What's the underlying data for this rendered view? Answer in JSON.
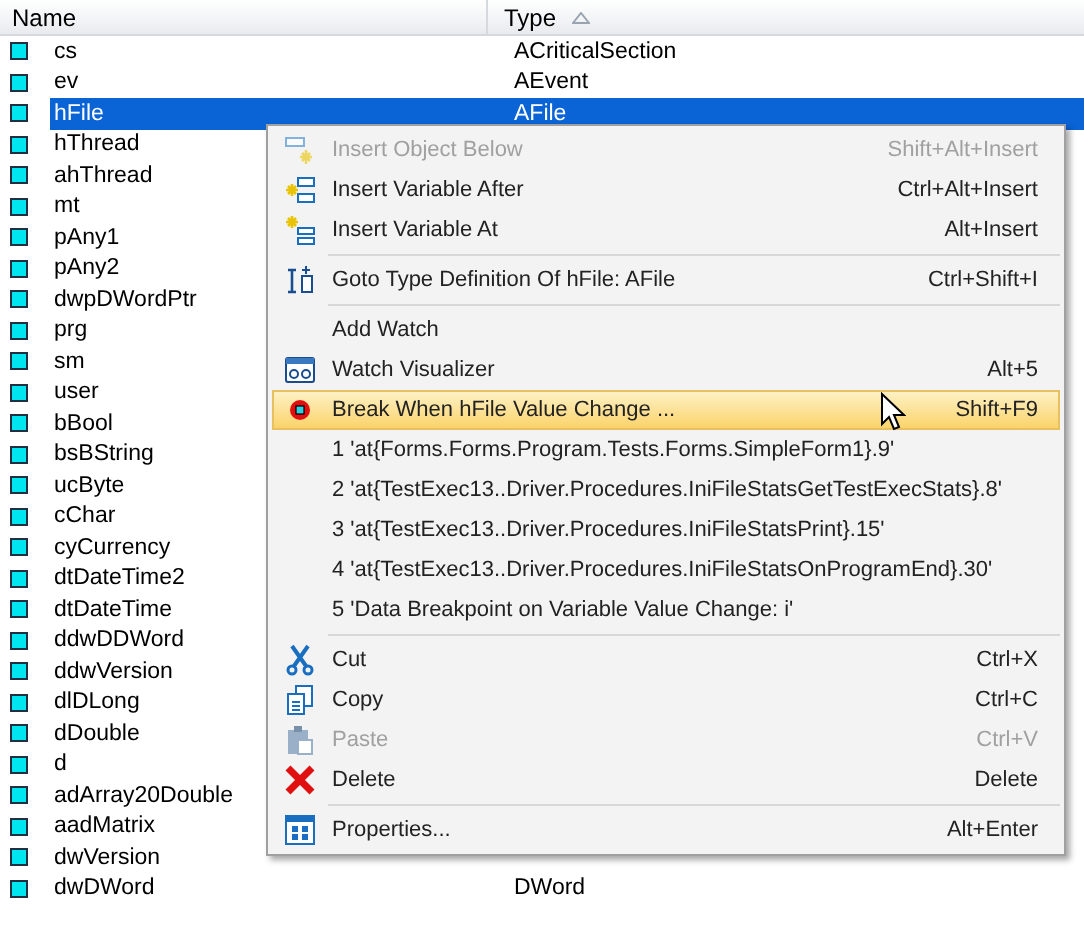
{
  "table": {
    "columns": [
      {
        "label": "Name"
      },
      {
        "label": "Type",
        "sorted": true
      }
    ],
    "rows": [
      {
        "name": "cs",
        "type": "ACriticalSection",
        "selected": false
      },
      {
        "name": "ev",
        "type": "AEvent",
        "selected": false
      },
      {
        "name": "hFile",
        "type": "AFile",
        "selected": true
      },
      {
        "name": "hThread",
        "selected": false
      },
      {
        "name": "ahThread",
        "selected": false
      },
      {
        "name": "mt",
        "selected": false
      },
      {
        "name": "pAny1",
        "selected": false
      },
      {
        "name": "pAny2",
        "selected": false
      },
      {
        "name": "dwpDWordPtr",
        "selected": false
      },
      {
        "name": "prg",
        "selected": false
      },
      {
        "name": "sm",
        "selected": false
      },
      {
        "name": "user",
        "selected": false
      },
      {
        "name": "bBool",
        "selected": false
      },
      {
        "name": "bsBString",
        "selected": false
      },
      {
        "name": "ucByte",
        "selected": false
      },
      {
        "name": "cChar",
        "selected": false
      },
      {
        "name": "cyCurrency",
        "selected": false
      },
      {
        "name": "dtDateTime2",
        "selected": false
      },
      {
        "name": "dtDateTime",
        "selected": false
      },
      {
        "name": "ddwDDWord",
        "selected": false
      },
      {
        "name": "ddwVersion",
        "selected": false
      },
      {
        "name": "dlDLong",
        "selected": false
      },
      {
        "name": "dDouble",
        "selected": false
      },
      {
        "name": "d",
        "selected": false
      },
      {
        "name": "adArray20Double",
        "selected": false
      },
      {
        "name": "aadMatrix",
        "selected": false
      },
      {
        "name": "dwVersion",
        "selected": false
      },
      {
        "name": "dwDWord",
        "type": "DWord",
        "selected": false
      }
    ]
  },
  "context_menu": {
    "items": [
      {
        "kind": "item",
        "label": "Insert Object Below",
        "shortcut": "Shift+Alt+Insert",
        "disabled": true,
        "selected": false
      },
      {
        "kind": "item",
        "label": "Insert Variable After",
        "shortcut": "Ctrl+Alt+Insert",
        "disabled": false,
        "selected": false
      },
      {
        "kind": "item",
        "label": "Insert Variable At",
        "shortcut": "Alt+Insert",
        "disabled": false,
        "selected": false
      },
      {
        "kind": "separator"
      },
      {
        "kind": "item",
        "label": "Goto Type Definition Of hFile: AFile",
        "shortcut": "Ctrl+Shift+I",
        "disabled": false,
        "selected": false
      },
      {
        "kind": "separator"
      },
      {
        "kind": "item",
        "label": "Add Watch",
        "disabled": false,
        "selected": false
      },
      {
        "kind": "item",
        "label": "Watch Visualizer",
        "shortcut": "Alt+5",
        "disabled": false,
        "selected": false
      },
      {
        "kind": "item",
        "label": "Break When hFile Value Change ...",
        "shortcut": "Shift+F9",
        "disabled": false,
        "selected": true
      },
      {
        "kind": "item",
        "label": "1 'at{Forms.Forms.Program.Tests.Forms.SimpleForm1}.9'",
        "disabled": false,
        "selected": false
      },
      {
        "kind": "item",
        "label": "2 'at{TestExec13..Driver.Procedures.IniFileStatsGetTestExecStats}.8'",
        "disabled": false,
        "selected": false
      },
      {
        "kind": "item",
        "label": "3 'at{TestExec13..Driver.Procedures.IniFileStatsPrint}.15'",
        "disabled": false,
        "selected": false
      },
      {
        "kind": "item",
        "label": "4 'at{TestExec13..Driver.Procedures.IniFileStatsOnProgramEnd}.30'",
        "disabled": false,
        "selected": false
      },
      {
        "kind": "item",
        "label": "5 'Data Breakpoint on Variable Value Change: i'",
        "disabled": false,
        "selected": false
      },
      {
        "kind": "separator"
      },
      {
        "kind": "item",
        "label": "Cut",
        "shortcut": "Ctrl+X",
        "disabled": false,
        "selected": false
      },
      {
        "kind": "item",
        "label": "Copy",
        "shortcut": "Ctrl+C",
        "disabled": false,
        "selected": false
      },
      {
        "kind": "item",
        "label": "Paste",
        "shortcut": "Ctrl+V",
        "disabled": true,
        "selected": false
      },
      {
        "kind": "item",
        "label": "Delete",
        "shortcut": "Delete",
        "disabled": false,
        "selected": false
      },
      {
        "kind": "separator"
      },
      {
        "kind": "item",
        "label": "Properties...",
        "shortcut": "Alt+Enter",
        "disabled": false,
        "selected": false
      }
    ]
  }
}
